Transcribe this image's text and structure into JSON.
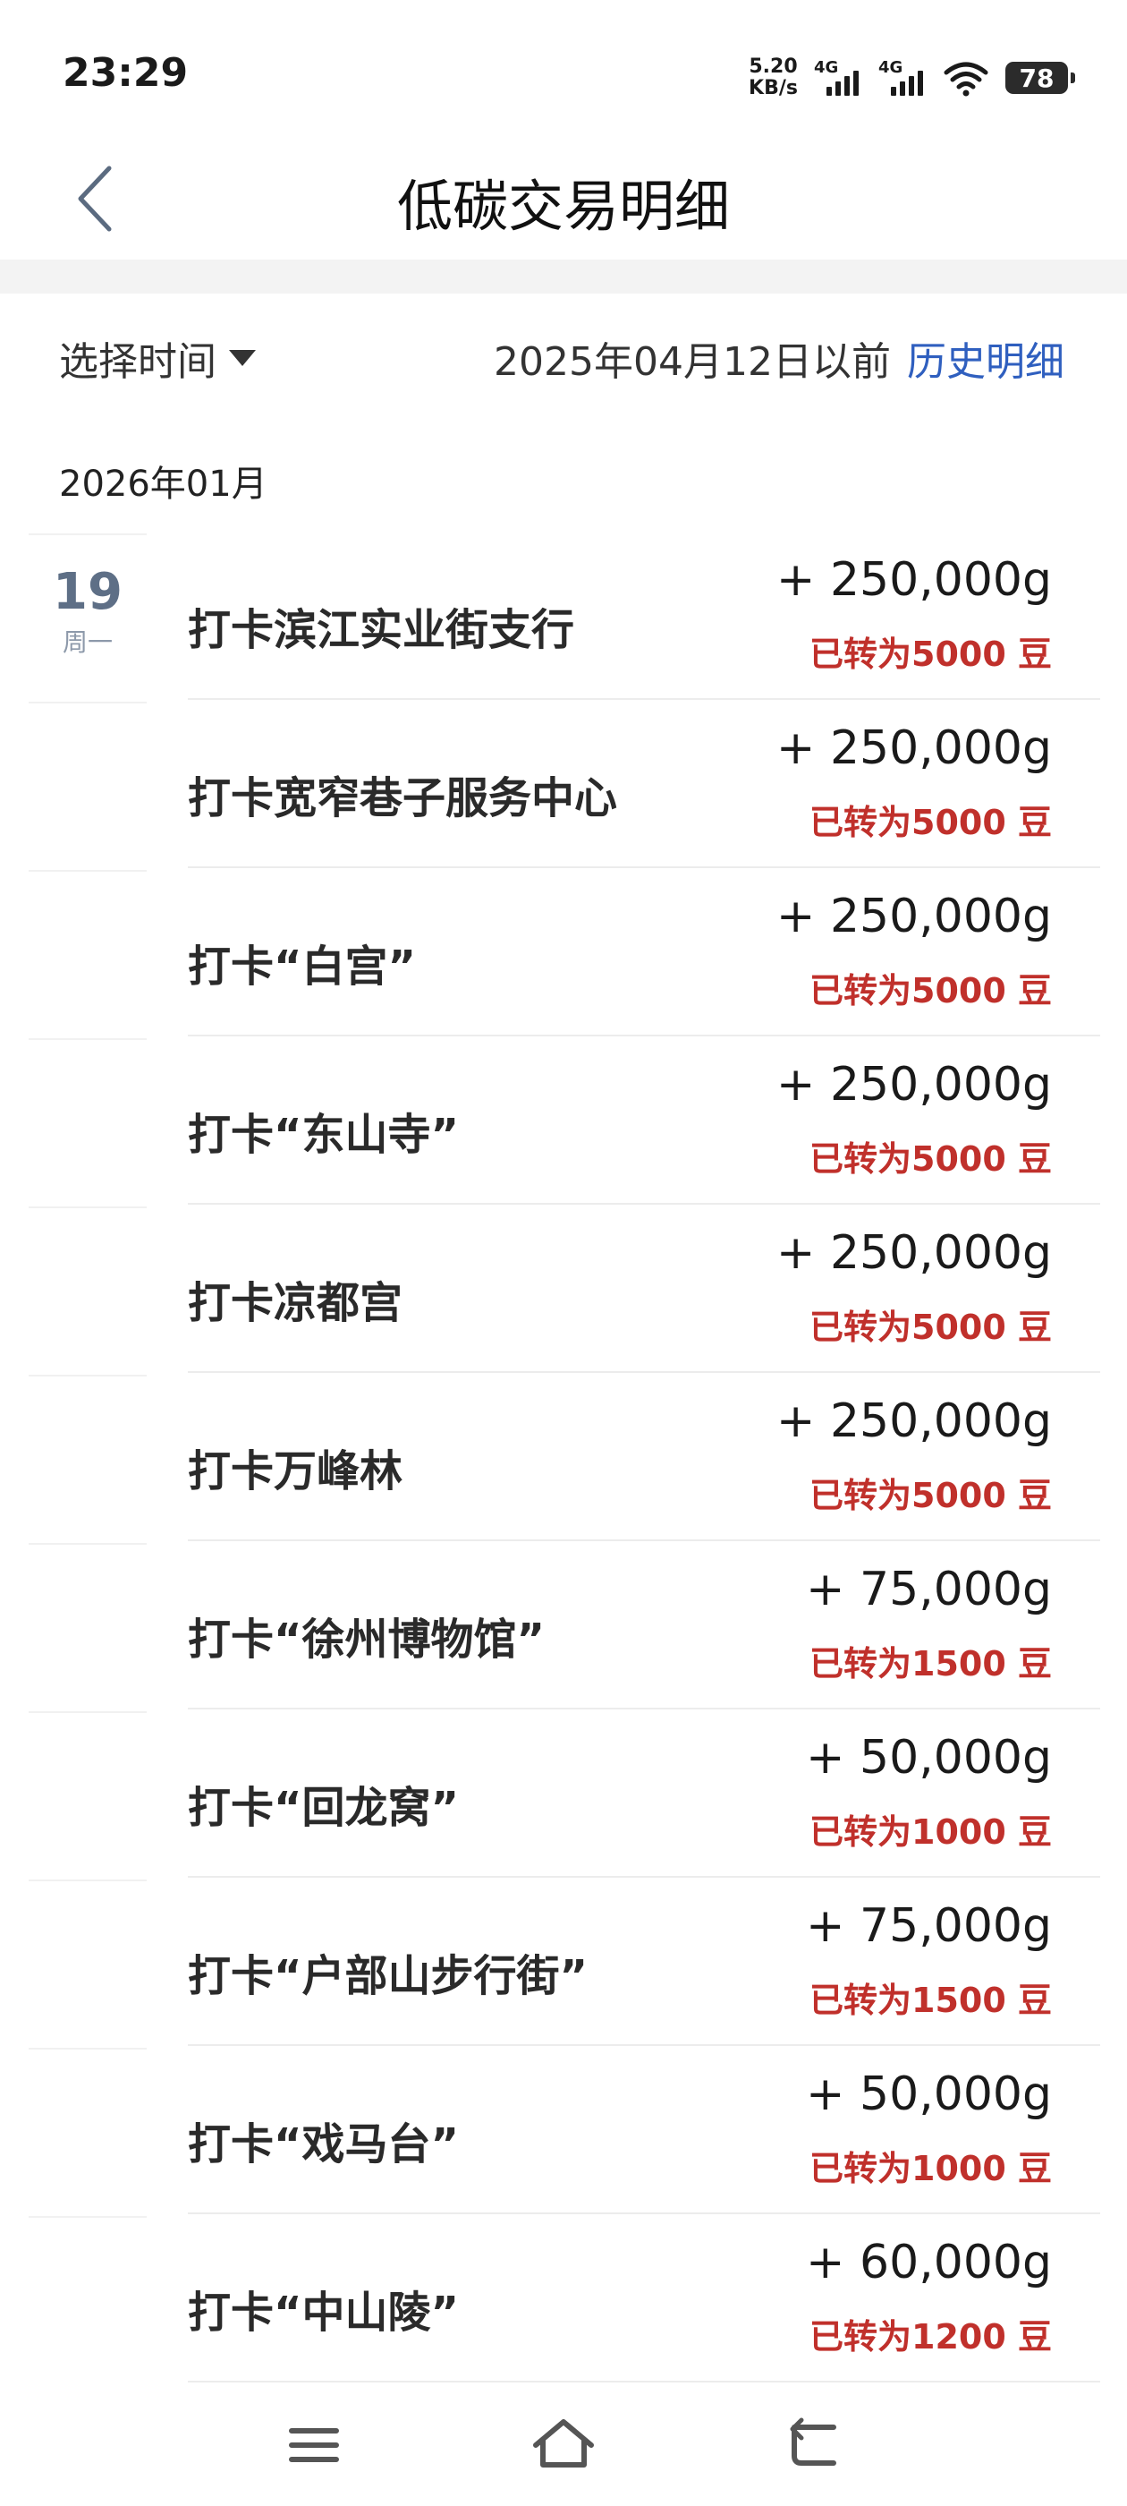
{
  "status": {
    "time": "23:29",
    "net_speed_value": "5.20",
    "net_speed_unit": "KB/s",
    "signal1_label": "4G",
    "signal2_label": "4G",
    "battery": "78"
  },
  "header": {
    "title": "低碳交易明细",
    "back_icon": "chevron-left-icon"
  },
  "filter": {
    "select_label": "选择时间",
    "before_date": "2025年04月12日以前",
    "history_link": "历史明细"
  },
  "month": "2026年01月",
  "day_group": {
    "day": "19",
    "weekday": "周一"
  },
  "transactions": [
    {
      "title": "打卡滨江实业街支行",
      "amount": "+ 250,000g",
      "converted": "已转为5000 豆"
    },
    {
      "title": "打卡宽窄巷子服务中心",
      "amount": "+ 250,000g",
      "converted": "已转为5000 豆"
    },
    {
      "title": "打卡“白宫”",
      "amount": "+ 250,000g",
      "converted": "已转为5000 豆"
    },
    {
      "title": "打卡“东山寺”",
      "amount": "+ 250,000g",
      "converted": "已转为5000 豆"
    },
    {
      "title": "打卡凉都宫",
      "amount": "+ 250,000g",
      "converted": "已转为5000 豆"
    },
    {
      "title": "打卡万峰林",
      "amount": "+ 250,000g",
      "converted": "已转为5000 豆"
    },
    {
      "title": "打卡“徐州博物馆”",
      "amount": "+ 75,000g",
      "converted": "已转为1500 豆"
    },
    {
      "title": "打卡“回龙窝”",
      "amount": "+ 50,000g",
      "converted": "已转为1000 豆"
    },
    {
      "title": "打卡“户部山步行街”",
      "amount": "+ 75,000g",
      "converted": "已转为1500 豆"
    },
    {
      "title": "打卡“戏马台”",
      "amount": "+ 50,000g",
      "converted": "已转为1000 豆"
    },
    {
      "title": "打卡“中山陵”",
      "amount": "+ 60,000g",
      "converted": "已转为1200 豆"
    }
  ],
  "colors": {
    "accent_link": "#2f5fbf",
    "converted_red": "#c0302b",
    "day_number": "#5e6f86"
  },
  "nav": {
    "menu_icon": "menu-icon",
    "home_icon": "home-icon",
    "back_icon": "return-icon"
  }
}
